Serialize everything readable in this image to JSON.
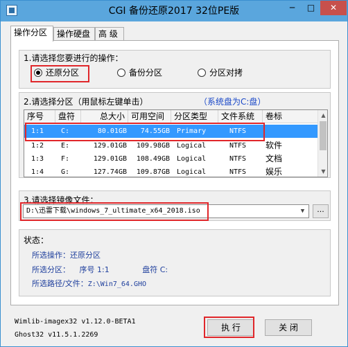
{
  "window": {
    "title": "CGI 备份还原2017 32位PE版",
    "minimize_glyph": "─",
    "maximize_glyph": "□",
    "close_glyph": "✕"
  },
  "tabs": [
    "操作分区",
    "操作硬盘",
    "高 级"
  ],
  "operation_group": {
    "label": "1.请选择您要进行的操作：",
    "options": [
      "还原分区",
      "备份分区",
      "分区对拷"
    ],
    "selected": "还原分区"
  },
  "partition_group": {
    "label": "2.请选择分区（用鼠标左键单击）",
    "system_disk_note": "（系统盘为C:盘）",
    "columns": [
      "序号",
      "盘符",
      "总大小",
      "可用空间",
      "分区类型",
      "文件系统",
      "卷标"
    ],
    "rows": [
      {
        "index": "1:1",
        "drive": "C:",
        "total": "80.01GB",
        "free": "74.55GB",
        "type": "Primary",
        "fs": "NTFS",
        "label": "",
        "selected": true
      },
      {
        "index": "1:2",
        "drive": "E:",
        "total": "129.01GB",
        "free": "109.98GB",
        "type": "Logical",
        "fs": "NTFS",
        "label": "软件",
        "selected": false
      },
      {
        "index": "1:3",
        "drive": "F:",
        "total": "129.01GB",
        "free": "108.49GB",
        "type": "Logical",
        "fs": "NTFS",
        "label": "文档",
        "selected": false
      },
      {
        "index": "1:4",
        "drive": "G:",
        "total": "127.74GB",
        "free": "109.87GB",
        "type": "Logical",
        "fs": "NTFS",
        "label": "娱乐",
        "selected": false
      }
    ]
  },
  "image_group": {
    "label": "3.请选择镜像文件：",
    "path": "D:\\迅雷下载\\windows_7_ultimate_x64_2018.iso",
    "browse_label": "..."
  },
  "status": {
    "label": "状态：",
    "op_label": "所选操作：",
    "op_value": "还原分区",
    "part_label": "所选分区：",
    "part_index": "序号 1:1",
    "part_drive": "盘符 C:",
    "path_label": "所选路径/文件：",
    "path_value": "Z:\\Win7_64.GHO"
  },
  "versions": [
    "Wimlib-imagex32 v1.12.0-BETA1",
    "Ghost32 v11.5.1.2269"
  ],
  "buttons": {
    "execute": "执 行",
    "close": "关 闭"
  },
  "colors": {
    "highlight_box": "#e0262a",
    "selection": "#3399ff",
    "note_blue": "#1a48c8",
    "titlebar": "#5aa6dd"
  }
}
